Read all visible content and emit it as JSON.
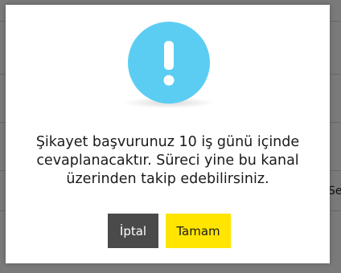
{
  "dialog": {
    "message_lines": [
      "Şikayet başvurunuz 10 iş günü içinde",
      "cevaplanacaktır. Süreci yine bu kanal",
      "üzerinden takip edebilirsiniz."
    ],
    "cancel_label": "İptal",
    "ok_label": "Tamam",
    "icon": "exclamation-icon"
  },
  "background": {
    "right_edge_fragment": "Se"
  },
  "colors": {
    "icon_circle": "#5ccdf2",
    "cancel_button": "#4a4a4a",
    "ok_button": "#ffe500",
    "overlay": "rgba(0,0,0,0.52)"
  }
}
